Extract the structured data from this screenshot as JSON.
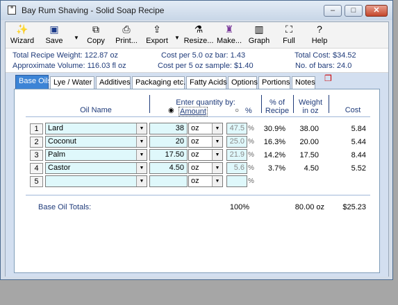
{
  "window": {
    "title": "Bay Rum Shaving - Solid Soap Recipe",
    "buttons": {
      "minimize": "–",
      "maximize": "□",
      "close": "✕"
    }
  },
  "toolbar": {
    "items": [
      {
        "label": "Wizard",
        "icon": "wand-icon"
      },
      {
        "label": "Save",
        "icon": "floppy-icon"
      },
      {
        "label": "Copy",
        "icon": "copy-icon"
      },
      {
        "label": "Print...",
        "icon": "printer-icon"
      },
      {
        "label": "Export",
        "icon": "export-icon"
      },
      {
        "label": "Resize...",
        "icon": "resize-icon"
      },
      {
        "label": "Make...",
        "icon": "make-icon"
      },
      {
        "label": "Graph",
        "icon": "graph-icon"
      },
      {
        "label": "Full",
        "icon": "fullscreen-icon"
      },
      {
        "label": "Help",
        "icon": "help-icon"
      }
    ]
  },
  "summary": {
    "total_weight": "Total Recipe Weight: 122.87 oz",
    "approx_volume": "Approximate Volume: 116.03 fl oz",
    "cost_per_bar": "Cost per 5.0 oz bar: 1.43",
    "cost_per_sample": "Cost per 5 oz sample: $1.40",
    "total_cost": "Total Cost: $34.52",
    "num_bars": "No. of bars: 24.0"
  },
  "tabs": [
    "Base Oils",
    "Lye / Water",
    "Additives",
    "Packaging etc.",
    "Fatty Acids",
    "Options",
    "Portions",
    "Notes"
  ],
  "table": {
    "headers": {
      "oil_name": "Oil Name",
      "enter_qty": "Enter quantity by:",
      "amount": "Amount",
      "percent": "%",
      "pct_recipe_1": "% of",
      "pct_recipe_2": "Recipe",
      "weight_1": "Weight",
      "weight_2": "in oz",
      "cost": "Cost"
    },
    "rows": [
      {
        "num": "1",
        "name": "Lard",
        "amount": "38",
        "unit": "oz",
        "pct_input": "47.5",
        "pct_sign": "%",
        "pct_recipe": "30.9%",
        "weight": "38.00",
        "cost": "5.84"
      },
      {
        "num": "2",
        "name": "Coconut",
        "amount": "20",
        "unit": "oz",
        "pct_input": "25.0",
        "pct_sign": "%",
        "pct_recipe": "16.3%",
        "weight": "20.00",
        "cost": "5.44"
      },
      {
        "num": "3",
        "name": "Palm",
        "amount": "17.50",
        "unit": "oz",
        "pct_input": "21.9",
        "pct_sign": "%",
        "pct_recipe": "14.2%",
        "weight": "17.50",
        "cost": "8.44"
      },
      {
        "num": "4",
        "name": "Castor",
        "amount": "4.50",
        "unit": "oz",
        "pct_input": "5.6",
        "pct_sign": "%",
        "pct_recipe": "3.7%",
        "weight": "4.50",
        "cost": "5.52"
      },
      {
        "num": "5",
        "name": "",
        "amount": "",
        "unit": "oz",
        "pct_input": "",
        "pct_sign": "%",
        "pct_recipe": "",
        "weight": "",
        "cost": ""
      }
    ],
    "totals": {
      "label": "Base Oil Totals:",
      "percent": "100%",
      "weight": "80.00 oz",
      "cost": "$25.23"
    }
  }
}
